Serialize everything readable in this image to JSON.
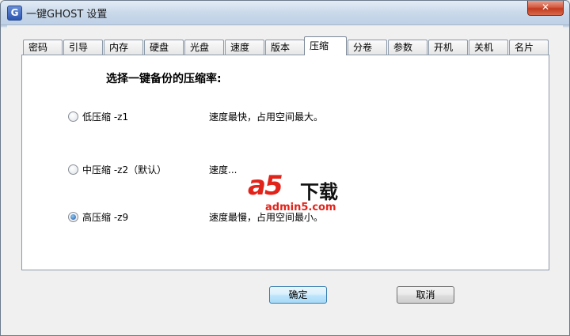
{
  "window": {
    "title": "一键GHOST 设置",
    "app_icon_letter": "G",
    "close_glyph": "✕"
  },
  "tabs": [
    {
      "label": "密码"
    },
    {
      "label": "引导"
    },
    {
      "label": "内存"
    },
    {
      "label": "硬盘"
    },
    {
      "label": "光盘"
    },
    {
      "label": "速度"
    },
    {
      "label": "版本"
    },
    {
      "label": "压缩",
      "active": true
    },
    {
      "label": "分卷"
    },
    {
      "label": "参数"
    },
    {
      "label": "开机"
    },
    {
      "label": "关机"
    },
    {
      "label": "名片"
    }
  ],
  "compression": {
    "heading": "选择一键备份的压缩率:",
    "selected": "high",
    "options": [
      {
        "key": "low",
        "label": "低压缩 -z1",
        "description": "速度最快，占用空间最大。"
      },
      {
        "key": "medium",
        "label": "中压缩 -z2（默认）",
        "description": "速度..."
      },
      {
        "key": "high",
        "label": "高压缩 -z9",
        "description": "速度最慢，占用空间最小。"
      }
    ]
  },
  "buttons": {
    "ok": "确定",
    "cancel": "取消"
  },
  "watermark": {
    "logo": "a5",
    "text": "下载",
    "url": "admin5.com"
  },
  "colors": {
    "watermark_red": "#e2231a",
    "default_button_border": "#3c7fb1"
  }
}
